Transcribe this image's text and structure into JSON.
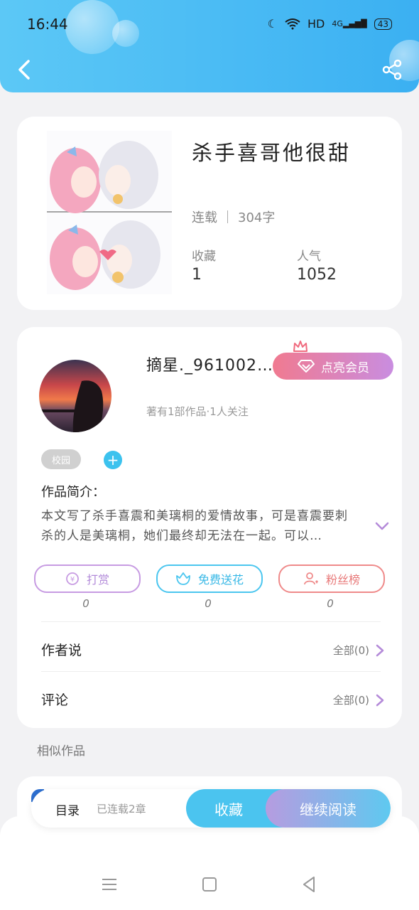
{
  "status_bar": {
    "time": "16:44",
    "network": "HD",
    "signal": "4G",
    "battery": "43"
  },
  "book": {
    "title": "杀手喜哥他很甜",
    "status": "连载",
    "word_count": "304字",
    "favorites_label": "收藏",
    "favorites_value": "1",
    "popularity_label": "人气",
    "popularity_value": "1052"
  },
  "author": {
    "name": "摘星._961002…",
    "vip_label": "点亮会员",
    "meta": "著有1部作品·1人关注",
    "tag": "校园"
  },
  "intro": {
    "label": "作品简介：",
    "text": "本文写了杀手喜震和美璃桐的爱情故事，可是喜震要刺杀的人是美璃桐，她们最终却无法在一起。可以…"
  },
  "actions": [
    {
      "label": "打赏",
      "count": "0"
    },
    {
      "label": "免费送花",
      "count": "0"
    },
    {
      "label": "粉丝榜",
      "count": "0"
    }
  ],
  "rows": [
    {
      "label": "作者说",
      "right": "全部(0)"
    },
    {
      "label": "评论",
      "right": "全部(0)"
    }
  ],
  "similar_title": "相似作品",
  "bottom_bar": {
    "catalog": "目录",
    "chapters": "已连载2章",
    "favorite": "收藏",
    "continue": "继续阅读"
  },
  "colors": {
    "header": "#3bb0f2",
    "accent_blue": "#4bc4ef",
    "vip_pink": "#f07a90"
  }
}
